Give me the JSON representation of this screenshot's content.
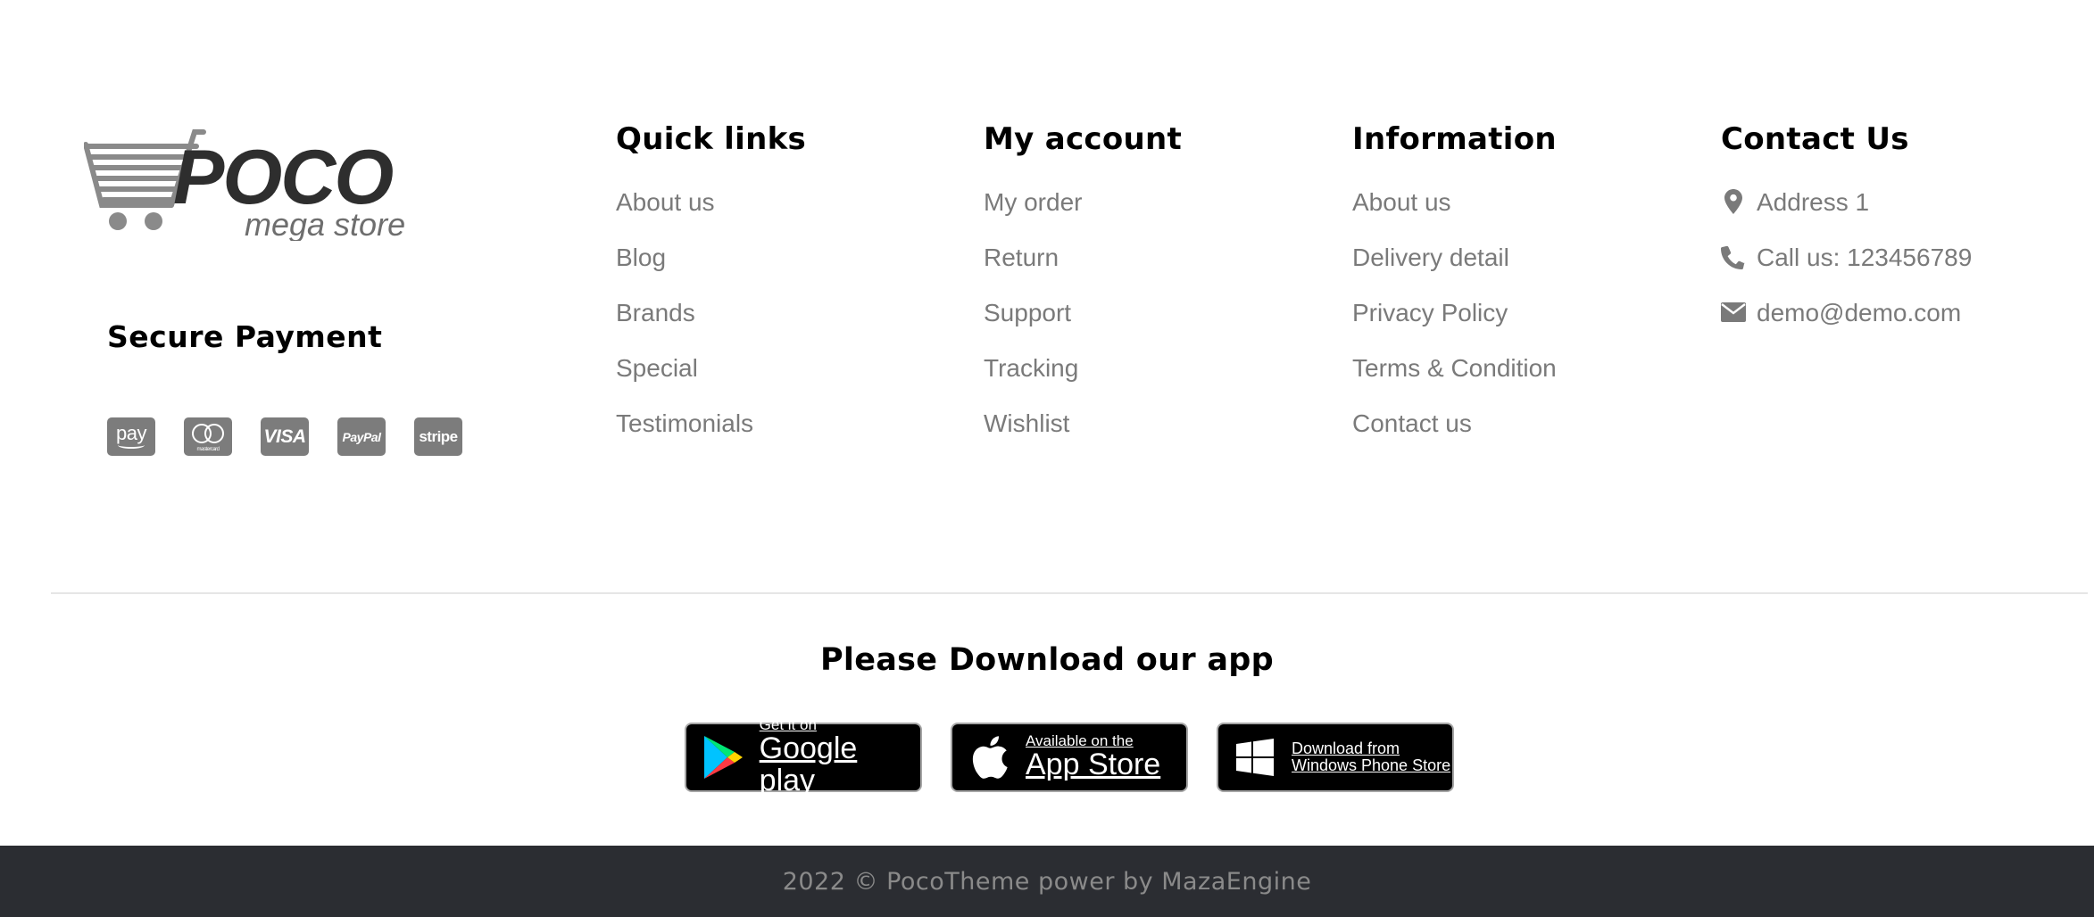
{
  "brand": {
    "name": "POCO",
    "tagline": "mega store"
  },
  "secure_payment": {
    "title": "Secure Payment",
    "methods": [
      {
        "label": "pay",
        "icon": "amazon-pay-icon"
      },
      {
        "label": "mastercard",
        "icon": "mastercard-icon"
      },
      {
        "label": "VISA",
        "icon": "visa-icon"
      },
      {
        "label": "PayPal",
        "icon": "paypal-icon"
      },
      {
        "label": "stripe",
        "icon": "stripe-icon"
      }
    ]
  },
  "quick_links": {
    "title": "Quick links",
    "items": [
      "About us",
      "Blog",
      "Brands",
      "Special",
      "Testimonials"
    ]
  },
  "my_account": {
    "title": "My account",
    "items": [
      "My order",
      "Return",
      "Support",
      "Tracking",
      "Wishlist"
    ]
  },
  "information": {
    "title": "Information",
    "items": [
      "About us",
      "Delivery detail",
      "Privacy Policy",
      "Terms & Condition",
      "Contact us"
    ]
  },
  "contact": {
    "title": "Contact Us",
    "items": [
      {
        "icon": "map-marker-icon",
        "text": "Address 1"
      },
      {
        "icon": "phone-icon",
        "text": "Call us: 123456789"
      },
      {
        "icon": "envelope-icon",
        "text": "demo@demo.com"
      }
    ]
  },
  "app_download": {
    "title": "Please Download our app",
    "stores": [
      {
        "small": "Get it on",
        "big": "Google play"
      },
      {
        "small": "Available on the",
        "big": "App Store"
      },
      {
        "small": "Download from",
        "big": "Windows Phone Store"
      }
    ]
  },
  "copyright": "2022 © PocoTheme power by MazaEngine",
  "colors": {
    "link_gray": "#7a7a7a",
    "footer_bar": "#2b2d32",
    "badge_gray": "#7c7c7c"
  }
}
